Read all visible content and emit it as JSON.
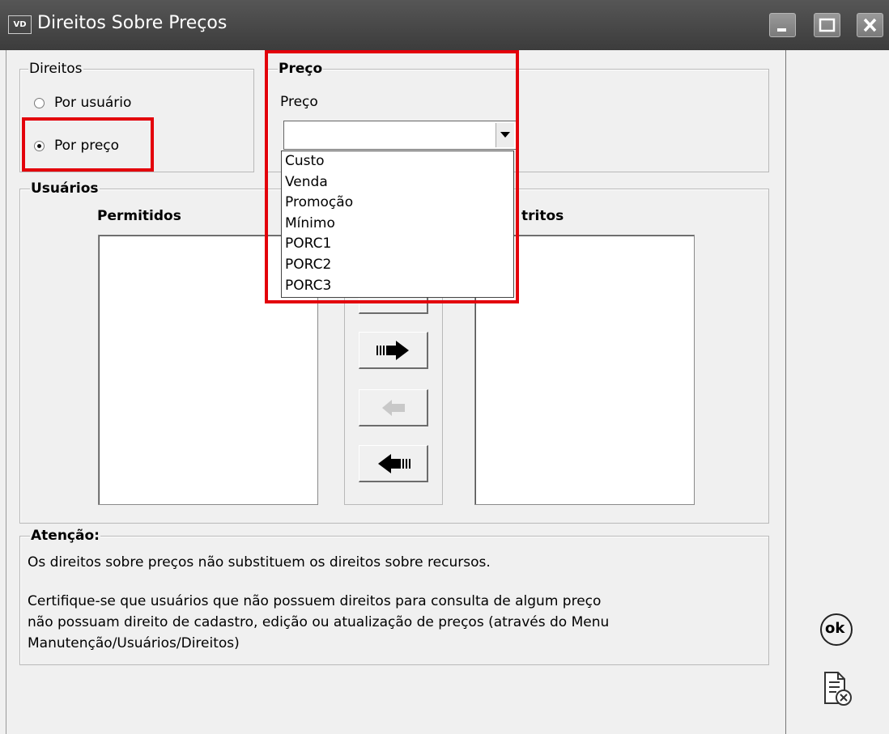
{
  "window": {
    "icon_label": "VD",
    "title": "Direitos Sobre Preços"
  },
  "direitos": {
    "label": "Direitos",
    "options": [
      {
        "label": "Por usuário",
        "selected": false
      },
      {
        "label": "Por preço",
        "selected": true
      }
    ]
  },
  "preco_group": {
    "label": "Preço",
    "field_label": "Preço",
    "combo_value": "",
    "dropdown_options": [
      "Custo",
      "Venda",
      "Promoção",
      "Mínimo",
      "PORC1",
      "PORC2",
      "PORC3"
    ]
  },
  "usuarios": {
    "label": "Usuários",
    "permitidos_header": "Permitidos",
    "restritos_header_visible": "tritos"
  },
  "atencao": {
    "label": "Atenção:",
    "line1": "Os direitos sobre preços não substituem os direitos sobre recursos.",
    "line2": "Certifique-se que usuários que não possuem direitos para consulta de algum preço",
    "line3": "não possuam direito de cadastro, edição ou atualização de preços (através do Menu",
    "line4": "Manutenção/Usuários/Direitos)"
  },
  "actions": {
    "ok_label": "ok"
  },
  "colors": {
    "highlight": "#e3000b",
    "titlebar": "#474747"
  }
}
